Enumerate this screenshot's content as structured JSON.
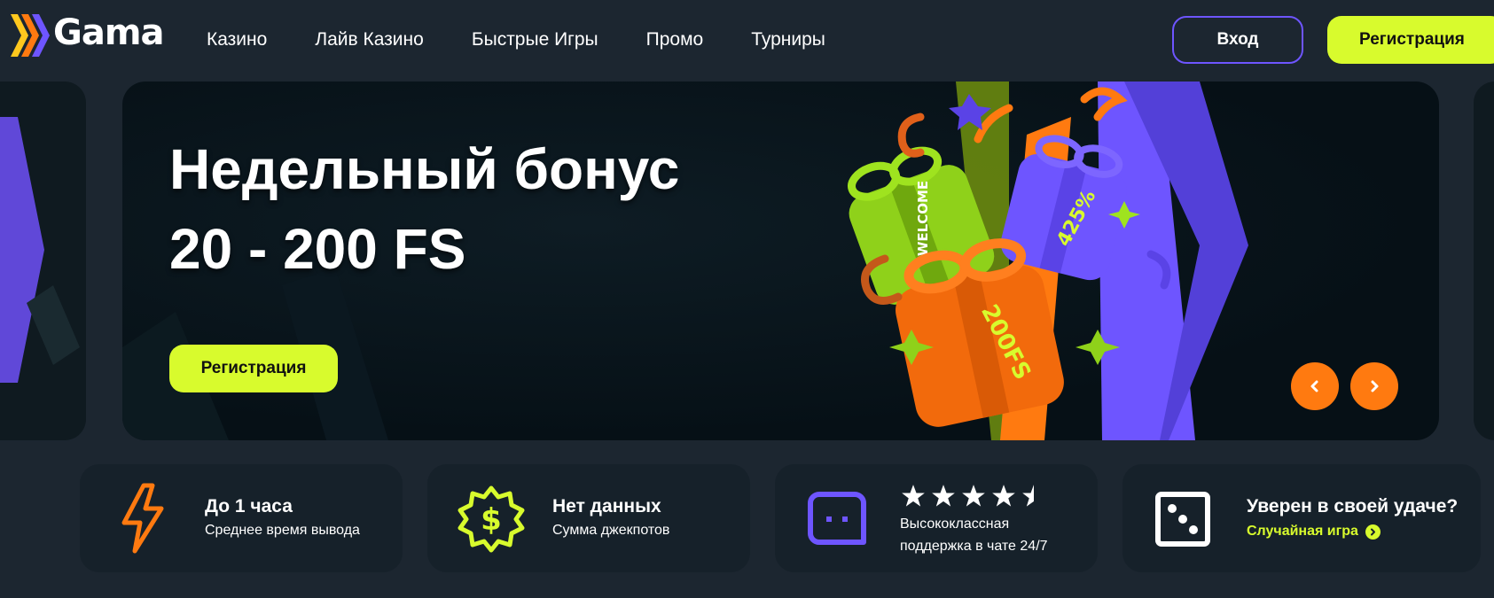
{
  "header": {
    "logo_text": "Gama",
    "nav": [
      "Казино",
      "Лайв Казино",
      "Быстрые Игры",
      "Промо",
      "Турниры"
    ],
    "login_label": "Вход",
    "register_label": "Регистрация"
  },
  "hero": {
    "title": "Недельный бонус",
    "subtitle": "20 - 200 FS",
    "cta_label": "Регистрация",
    "gift_labels": [
      "WELCOME",
      "425%",
      "200FS"
    ]
  },
  "features": {
    "payout": {
      "title": "До 1 часа",
      "subtitle": "Среднее время вывода"
    },
    "jackpot": {
      "title": "Нет данных",
      "subtitle": "Сумма джекпотов"
    },
    "support": {
      "rating": 4.5,
      "max_rating": 5,
      "line1": "Высококлассная",
      "line2": "поддержка в чате 24/7"
    },
    "random": {
      "title": "Уверен в своей удаче?",
      "link": "Случайная игра"
    }
  },
  "colors": {
    "accent_lime": "#d8fb2d",
    "accent_purple": "#6e55ff",
    "accent_orange": "#ff7a10",
    "background": "#1c2630",
    "card": "#16212a"
  },
  "icons": {
    "logo": "gama-chevrons-icon",
    "payout": "lightning-icon",
    "jackpot": "dollar-badge-icon",
    "support": "chat-bubble-icon",
    "random": "dice-icon",
    "prev": "chevron-left-icon",
    "next": "chevron-right-icon"
  }
}
